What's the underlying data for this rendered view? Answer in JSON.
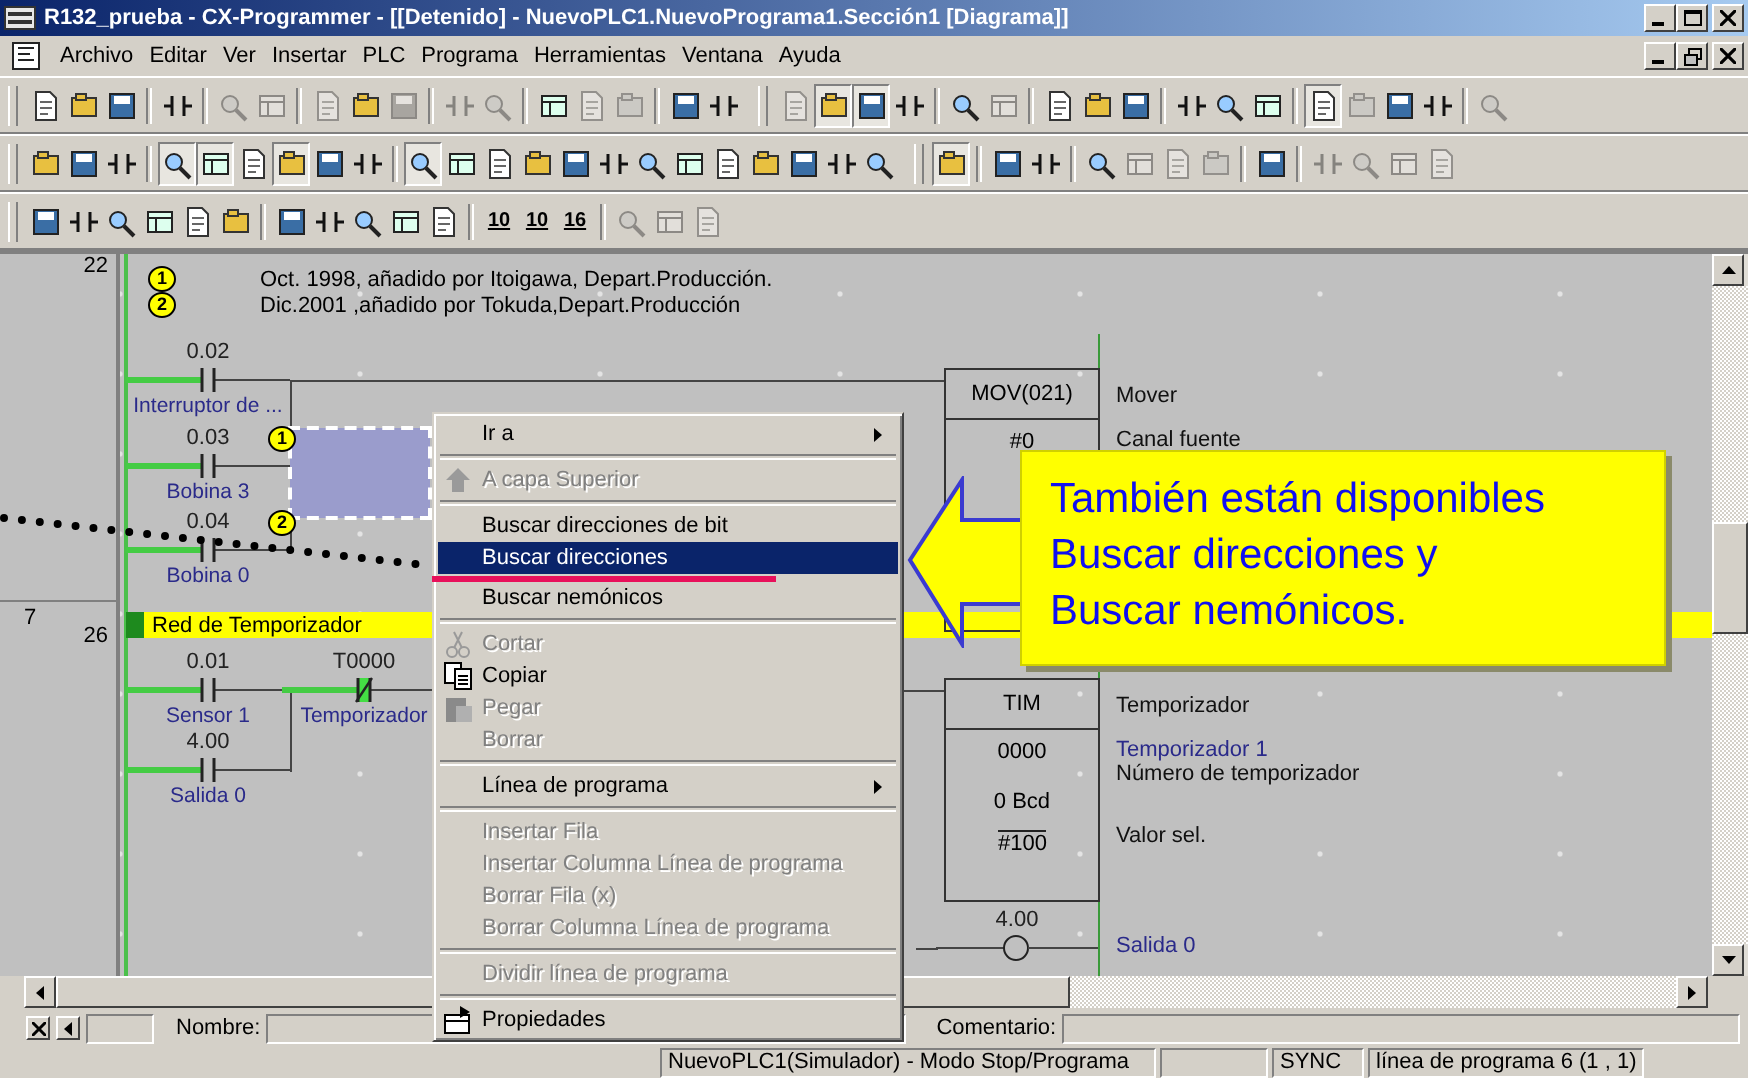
{
  "window": {
    "title": "R132_prueba - CX-Programmer - [[Detenido] - NuevoPLC1.NuevoPrograma1.Sección1 [Diagrama]]"
  },
  "menu_bar": [
    "Archivo",
    "Editar",
    "Ver",
    "Insertar",
    "PLC",
    "Programa",
    "Herramientas",
    "Ventana",
    "Ayuda"
  ],
  "toolbar_rows": [
    {
      "toolbars": [
        {
          "items": [
            {
              "kind": "button",
              "disabled": false,
              "pressed": false
            },
            {
              "kind": "button",
              "disabled": false,
              "pressed": false
            },
            {
              "kind": "button",
              "disabled": false,
              "pressed": false
            },
            {
              "kind": "separator"
            },
            {
              "kind": "button",
              "disabled": false,
              "pressed": false
            },
            {
              "kind": "separator"
            },
            {
              "kind": "button",
              "disabled": true,
              "pressed": false
            },
            {
              "kind": "button",
              "disabled": true,
              "pressed": false
            },
            {
              "kind": "separator"
            },
            {
              "kind": "button",
              "disabled": true,
              "pressed": false
            },
            {
              "kind": "button",
              "disabled": false,
              "pressed": false
            },
            {
              "kind": "button",
              "disabled": true,
              "pressed": false
            },
            {
              "kind": "separator"
            },
            {
              "kind": "button",
              "disabled": true,
              "pressed": false
            },
            {
              "kind": "button",
              "disabled": true,
              "pressed": false
            },
            {
              "kind": "separator"
            },
            {
              "kind": "button",
              "disabled": false,
              "pressed": false
            },
            {
              "kind": "button",
              "disabled": true,
              "pressed": false
            },
            {
              "kind": "button",
              "disabled": true,
              "pressed": false
            },
            {
              "kind": "separator"
            },
            {
              "kind": "button",
              "disabled": false,
              "pressed": false
            },
            {
              "kind": "button",
              "disabled": false,
              "pressed": false
            }
          ]
        },
        {
          "items": [
            {
              "kind": "button",
              "disabled": true,
              "pressed": false
            },
            {
              "kind": "button",
              "disabled": false,
              "pressed": true
            },
            {
              "kind": "button",
              "disabled": false,
              "pressed": true
            },
            {
              "kind": "button",
              "disabled": false,
              "pressed": false
            },
            {
              "kind": "separator"
            },
            {
              "kind": "button",
              "disabled": false,
              "pressed": false
            },
            {
              "kind": "button",
              "disabled": true,
              "pressed": false
            },
            {
              "kind": "separator"
            },
            {
              "kind": "button",
              "disabled": false,
              "pressed": false
            },
            {
              "kind": "button",
              "disabled": false,
              "pressed": false
            },
            {
              "kind": "button",
              "disabled": false,
              "pressed": false
            },
            {
              "kind": "separator"
            },
            {
              "kind": "button",
              "disabled": false,
              "pressed": false
            },
            {
              "kind": "button",
              "disabled": false,
              "pressed": false
            },
            {
              "kind": "button",
              "disabled": false,
              "pressed": false
            },
            {
              "kind": "separator"
            },
            {
              "kind": "button",
              "disabled": false,
              "pressed": true
            },
            {
              "kind": "button",
              "disabled": true,
              "pressed": false
            },
            {
              "kind": "button",
              "disabled": false,
              "pressed": false
            },
            {
              "kind": "button",
              "disabled": false,
              "pressed": false
            },
            {
              "kind": "separator"
            },
            {
              "kind": "button",
              "disabled": true,
              "pressed": false
            }
          ]
        }
      ]
    },
    {
      "toolbars": [
        {
          "items": [
            {
              "kind": "button",
              "disabled": false,
              "pressed": false
            },
            {
              "kind": "button",
              "disabled": false,
              "pressed": false
            },
            {
              "kind": "button",
              "disabled": false,
              "pressed": false
            },
            {
              "kind": "separator"
            },
            {
              "kind": "button",
              "disabled": false,
              "pressed": true
            },
            {
              "kind": "button",
              "disabled": false,
              "pressed": true
            },
            {
              "kind": "button",
              "disabled": false,
              "pressed": false
            },
            {
              "kind": "button",
              "disabled": false,
              "pressed": true
            },
            {
              "kind": "button",
              "disabled": false,
              "pressed": false
            },
            {
              "kind": "button",
              "disabled": false,
              "pressed": false
            },
            {
              "kind": "separator"
            },
            {
              "kind": "button",
              "disabled": false,
              "pressed": true
            },
            {
              "kind": "button",
              "disabled": false,
              "pressed": false
            },
            {
              "kind": "button",
              "disabled": false,
              "pressed": false
            },
            {
              "kind": "button",
              "disabled": false,
              "pressed": false
            },
            {
              "kind": "button",
              "disabled": false,
              "pressed": false
            },
            {
              "kind": "button",
              "disabled": false,
              "pressed": false
            },
            {
              "kind": "button",
              "disabled": false,
              "pressed": false
            },
            {
              "kind": "button",
              "disabled": false,
              "pressed": false
            },
            {
              "kind": "button",
              "disabled": false,
              "pressed": false
            },
            {
              "kind": "button",
              "disabled": false,
              "pressed": false
            },
            {
              "kind": "button",
              "disabled": false,
              "pressed": false
            },
            {
              "kind": "button",
              "disabled": false,
              "pressed": false
            },
            {
              "kind": "button",
              "disabled": false,
              "pressed": false
            }
          ]
        },
        {
          "items": [
            {
              "kind": "button",
              "disabled": false,
              "pressed": true
            },
            {
              "kind": "separator"
            },
            {
              "kind": "button",
              "disabled": false,
              "pressed": false
            },
            {
              "kind": "button",
              "disabled": false,
              "pressed": false
            },
            {
              "kind": "separator"
            },
            {
              "kind": "button",
              "disabled": false,
              "pressed": false
            },
            {
              "kind": "button",
              "disabled": true,
              "pressed": false
            },
            {
              "kind": "button",
              "disabled": true,
              "pressed": false
            },
            {
              "kind": "button",
              "disabled": true,
              "pressed": false
            },
            {
              "kind": "separator"
            },
            {
              "kind": "button",
              "disabled": false,
              "pressed": false
            },
            {
              "kind": "separator"
            },
            {
              "kind": "button",
              "disabled": true,
              "pressed": false
            },
            {
              "kind": "button",
              "disabled": true,
              "pressed": false
            },
            {
              "kind": "button",
              "disabled": true,
              "pressed": false
            },
            {
              "kind": "button",
              "disabled": true,
              "pressed": false
            }
          ]
        }
      ]
    },
    {
      "toolbars": [
        {
          "items": [
            {
              "kind": "button",
              "disabled": false,
              "pressed": false
            },
            {
              "kind": "button",
              "disabled": false,
              "pressed": false
            },
            {
              "kind": "button",
              "disabled": false,
              "pressed": false
            },
            {
              "kind": "button",
              "disabled": false,
              "pressed": false
            },
            {
              "kind": "button",
              "disabled": false,
              "pressed": false
            },
            {
              "kind": "button",
              "disabled": false,
              "pressed": false
            },
            {
              "kind": "separator"
            },
            {
              "kind": "button",
              "disabled": false,
              "pressed": false
            },
            {
              "kind": "button",
              "disabled": false,
              "pressed": false
            },
            {
              "kind": "button",
              "disabled": false,
              "pressed": false
            },
            {
              "kind": "button",
              "disabled": false,
              "pressed": false
            },
            {
              "kind": "button",
              "disabled": false,
              "pressed": false
            },
            {
              "kind": "separator"
            },
            {
              "kind": "text",
              "label": "10",
              "disabled": false,
              "pressed": false
            },
            {
              "kind": "text",
              "label": "10",
              "disabled": false,
              "pressed": false
            },
            {
              "kind": "text",
              "label": "16",
              "disabled": false,
              "pressed": false
            },
            {
              "kind": "separator"
            },
            {
              "kind": "button",
              "disabled": true,
              "pressed": false
            },
            {
              "kind": "button",
              "disabled": true,
              "pressed": false
            },
            {
              "kind": "button",
              "disabled": true,
              "pressed": false
            }
          ]
        }
      ]
    }
  ],
  "diagram": {
    "gutter": [
      {
        "step": "22"
      },
      {
        "line": "7",
        "step": "26"
      }
    ],
    "comments": [
      {
        "marker": "1",
        "text": "Oct. 1998, añadido por Itoigawa, Depart.Producción."
      },
      {
        "marker": "2",
        "text": "Dic.2001 ,añadido por Tokuda,Depart.Producción"
      }
    ],
    "selection": {
      "visible": true
    },
    "rungs": [
      {
        "contacts": [
          {
            "kind": "no",
            "address": "0.02",
            "name": "Interruptor de ...",
            "powered": true
          },
          {
            "kind": "no",
            "address": "0.03",
            "name": "Bobina 3",
            "powered": true,
            "marker": "1"
          },
          {
            "kind": "no",
            "address": "0.04",
            "name": "Bobina 0",
            "powered": true,
            "marker": "2"
          }
        ],
        "instruction": {
          "mnemonic": "MOV(021)",
          "operands": [
            "#0"
          ]
        },
        "notes": [
          {
            "kind": "comment",
            "text": "Mover"
          },
          {
            "kind": "comment",
            "text": "Canal fuente"
          }
        ]
      },
      {
        "section": "Red de Temporizador",
        "contacts": [
          {
            "kind": "no",
            "address": "0.01",
            "name": "Sensor 1",
            "powered": true
          },
          {
            "kind": "nc",
            "address": "T0000",
            "name": "Temporizador",
            "powered": true
          },
          {
            "kind": "no",
            "address": "4.00",
            "name": "Salida 0",
            "powered": true
          }
        ],
        "instruction": {
          "mnemonic": "TIM",
          "operands": [
            "0000",
            "0 Bcd",
            "#100"
          ]
        },
        "notes": [
          {
            "kind": "comment",
            "text": "Temporizador"
          },
          {
            "kind": "name",
            "text": "Temporizador 1"
          },
          {
            "kind": "comment",
            "text": "Número de temporizador"
          },
          {
            "kind": "comment",
            "text": "Valor sel."
          },
          {
            "kind": "name",
            "text": "Salida 0"
          }
        ],
        "coil": {
          "address": "4.00"
        }
      }
    ]
  },
  "context_menu": [
    {
      "kind": "submenu",
      "label": "Ir a",
      "disabled": false,
      "selected": false,
      "has_icon": false
    },
    {
      "kind": "separator"
    },
    {
      "kind": "item",
      "label": "A capa Superior",
      "disabled": true,
      "selected": false,
      "has_icon": true
    },
    {
      "kind": "separator"
    },
    {
      "kind": "item",
      "label": "Buscar direcciones de bit",
      "disabled": false,
      "selected": false,
      "has_icon": false
    },
    {
      "kind": "item",
      "label": "Buscar direcciones",
      "disabled": false,
      "selected": true,
      "has_icon": false
    },
    {
      "kind": "item",
      "label": "Buscar nemónicos",
      "disabled": false,
      "selected": false,
      "has_icon": false
    },
    {
      "kind": "separator"
    },
    {
      "kind": "item",
      "label": "Cortar",
      "disabled": true,
      "selected": false,
      "has_icon": true
    },
    {
      "kind": "item",
      "label": "Copiar",
      "disabled": false,
      "selected": false,
      "has_icon": true
    },
    {
      "kind": "item",
      "label": "Pegar",
      "disabled": true,
      "selected": false,
      "has_icon": true
    },
    {
      "kind": "item",
      "label": "Borrar",
      "disabled": true,
      "selected": false,
      "has_icon": false
    },
    {
      "kind": "separator"
    },
    {
      "kind": "submenu",
      "label": "Línea de programa",
      "disabled": false,
      "selected": false,
      "has_icon": false
    },
    {
      "kind": "separator"
    },
    {
      "kind": "item",
      "label": "Insertar Fila",
      "disabled": true,
      "selected": false,
      "has_icon": false
    },
    {
      "kind": "item",
      "label": "Insertar Columna Línea de programa",
      "disabled": true,
      "selected": false,
      "has_icon": false
    },
    {
      "kind": "item",
      "label": "Borrar Fila (x)",
      "disabled": true,
      "selected": false,
      "has_icon": false
    },
    {
      "kind": "item",
      "label": "Borrar Columna Línea de programa",
      "disabled": true,
      "selected": false,
      "has_icon": false
    },
    {
      "kind": "separator"
    },
    {
      "kind": "item",
      "label": "Dividir línea de programa",
      "disabled": true,
      "selected": false,
      "has_icon": false
    },
    {
      "kind": "separator"
    },
    {
      "kind": "item",
      "label": "Propiedades",
      "disabled": false,
      "selected": false,
      "has_icon": true
    }
  ],
  "callout": {
    "text": "También están disponibles\nBuscar direcciones y\nBuscar nemónicos."
  },
  "info_bar": {
    "name_label": "Nombre:",
    "comment_label": "Comentario:"
  },
  "status_bar": [
    "NuevoPLC1(Simulador) - Modo Stop/Programa",
    "SYNC",
    "línea de programa 6 (1 , 1)"
  ]
}
